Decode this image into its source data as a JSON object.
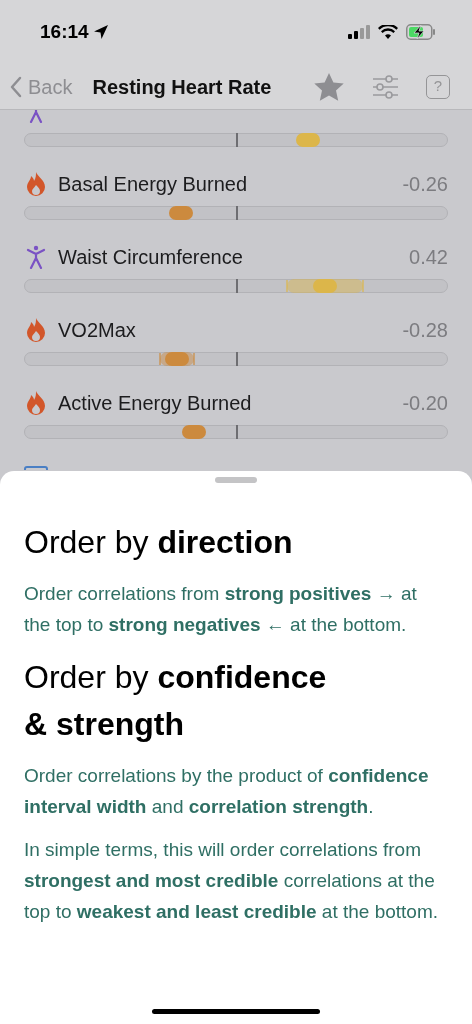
{
  "status_bar": {
    "time": "16:14"
  },
  "nav": {
    "back": "Back",
    "title": "Resting Heart Rate",
    "help": "?"
  },
  "correlations": [
    {
      "kind": "figure",
      "color": "#dcb64a",
      "level": 0.67
    },
    {
      "name": "Basal Energy Burned",
      "value": "-0.26",
      "kind": "flame",
      "color": "#cc8a3e",
      "level": 0.37
    },
    {
      "name": "Waist Circumference",
      "value": "0.42",
      "kind": "figure",
      "color": "#dcb64a",
      "level": 0.71,
      "band_start": {
        "level": 0.62
      },
      "band_end": {
        "level": 0.8
      }
    },
    {
      "name": "VO2Max",
      "value": "-0.28",
      "kind": "flame",
      "color": "#cc8a3e",
      "level": 0.36,
      "band_start": {
        "level": 0.32
      },
      "band_end": {
        "level": 0.4
      }
    },
    {
      "name": "Active Energy Burned",
      "value": "-0.20",
      "kind": "flame",
      "color": "#cc8a3e",
      "level": 0.4
    },
    {
      "kind": "monitor"
    }
  ],
  "sheet": {
    "sections": [
      {
        "heading": "Order by **direction**",
        "paragraphs": [
          "Order correlations from **strong positives →** at the top to **strong negatives ←** at the bottom."
        ]
      },
      {
        "heading": "Order by **confidence & strength**",
        "paragraphs": [
          "Order correlations by the product of **confidence interval width** and **correlation strength**.",
          "In simple terms, this will order correlations from **strongest and most credible** correlations at the top to **weakest and least credible** at the bottom."
        ]
      }
    ]
  }
}
